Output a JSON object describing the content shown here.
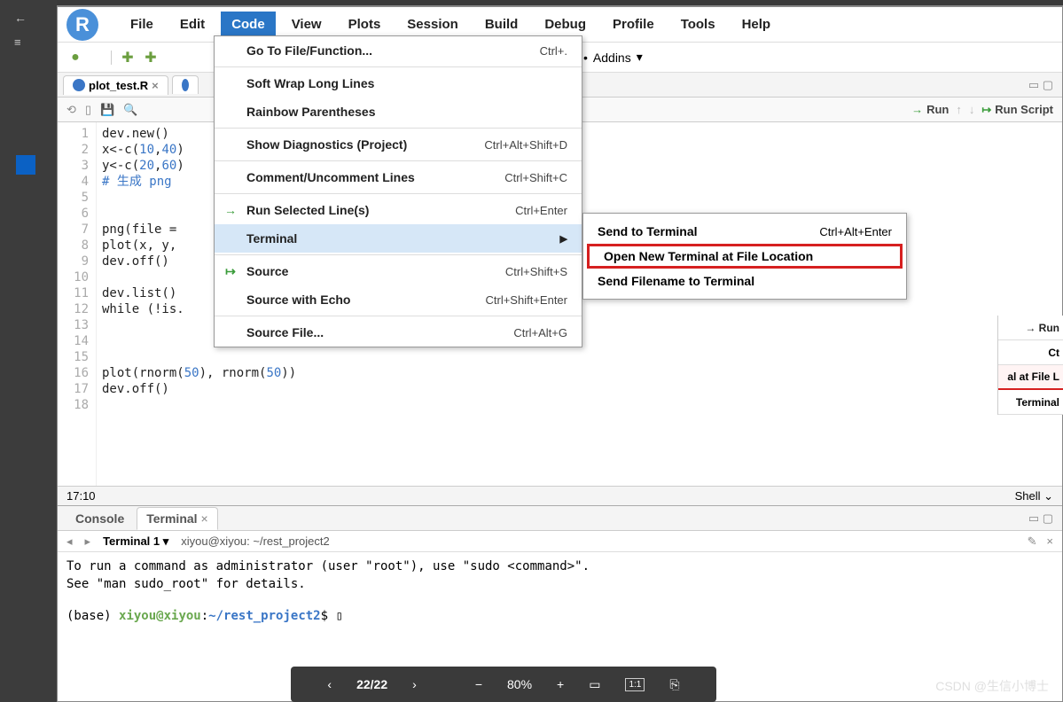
{
  "menubar": {
    "items": [
      "File",
      "Edit",
      "Code",
      "View",
      "Plots",
      "Session",
      "Build",
      "Debug",
      "Profile",
      "Tools",
      "Help"
    ],
    "active_index": 2,
    "addins_label": "Addins"
  },
  "tabs": {
    "file": "plot_test.R"
  },
  "editor_toolbar": {
    "run": "Run",
    "run_script": "Run Script"
  },
  "code": {
    "lines": [
      "dev.new()",
      "x<-c(10,40)",
      "y<-c(20,60)",
      "# 生成 png",
      "",
      "",
      "png(file = ",
      "plot(x, y,",
      "dev.off()",
      "",
      "dev.list()",
      "while (!is.",
      "",
      "",
      "",
      "plot(rnorm(50), rnorm(50))",
      "dev.off()",
      ""
    ]
  },
  "status": {
    "pos": "17:10",
    "lang": "Shell"
  },
  "bottom": {
    "tabs": [
      "Console",
      "Terminal"
    ],
    "active": 1,
    "terminal_name": "Terminal 1",
    "terminal_path": "xiyou@xiyou: ~/rest_project2",
    "output_line1": "To run a command as administrator (user \"root\"), use \"sudo <command>\".",
    "output_line2": "See \"man sudo_root\" for details.",
    "prompt_prefix": "(base) ",
    "prompt_user": "xiyou@xiyou",
    "prompt_colon": ":",
    "prompt_path": "~/rest_project2",
    "prompt_dollar": "$"
  },
  "dropdown": {
    "items": [
      {
        "label": "Go To File/Function...",
        "shortcut": "Ctrl+.",
        "sep_before": false
      },
      {
        "label": "Soft Wrap Long Lines",
        "sep_before": true
      },
      {
        "label": "Rainbow Parentheses"
      },
      {
        "label": "Show Diagnostics (Project)",
        "shortcut": "Ctrl+Alt+Shift+D",
        "sep_before": true
      },
      {
        "label": "Comment/Uncomment Lines",
        "shortcut": "Ctrl+Shift+C",
        "sep_before": true
      },
      {
        "label": "Run Selected Line(s)",
        "shortcut": "Ctrl+Enter",
        "icon": "→",
        "sep_before": true
      },
      {
        "label": "Terminal",
        "has_sub": true,
        "highlight": true
      },
      {
        "label": "Source",
        "shortcut": "Ctrl+Shift+S",
        "icon": "↦",
        "sep_before": true
      },
      {
        "label": "Source with Echo",
        "shortcut": "Ctrl+Shift+Enter"
      },
      {
        "label": "Source File...",
        "shortcut": "Ctrl+Alt+G",
        "sep_before": true
      }
    ]
  },
  "submenu": {
    "items": [
      {
        "label": "Send to Terminal",
        "shortcut": "Ctrl+Alt+Enter"
      },
      {
        "label": "Open New Terminal at File Location",
        "boxed": true
      },
      {
        "label": "Send Filename to Terminal"
      }
    ]
  },
  "right_fragments": [
    {
      "text": "→ Run",
      "run": true
    },
    {
      "text": "Ct"
    },
    {
      "text": "al at File L",
      "hl": true
    },
    {
      "text": "Terminal"
    }
  ],
  "viewer": {
    "page": "22/22",
    "zoom": "80%"
  },
  "watermark": "CSDN @生信小博士"
}
